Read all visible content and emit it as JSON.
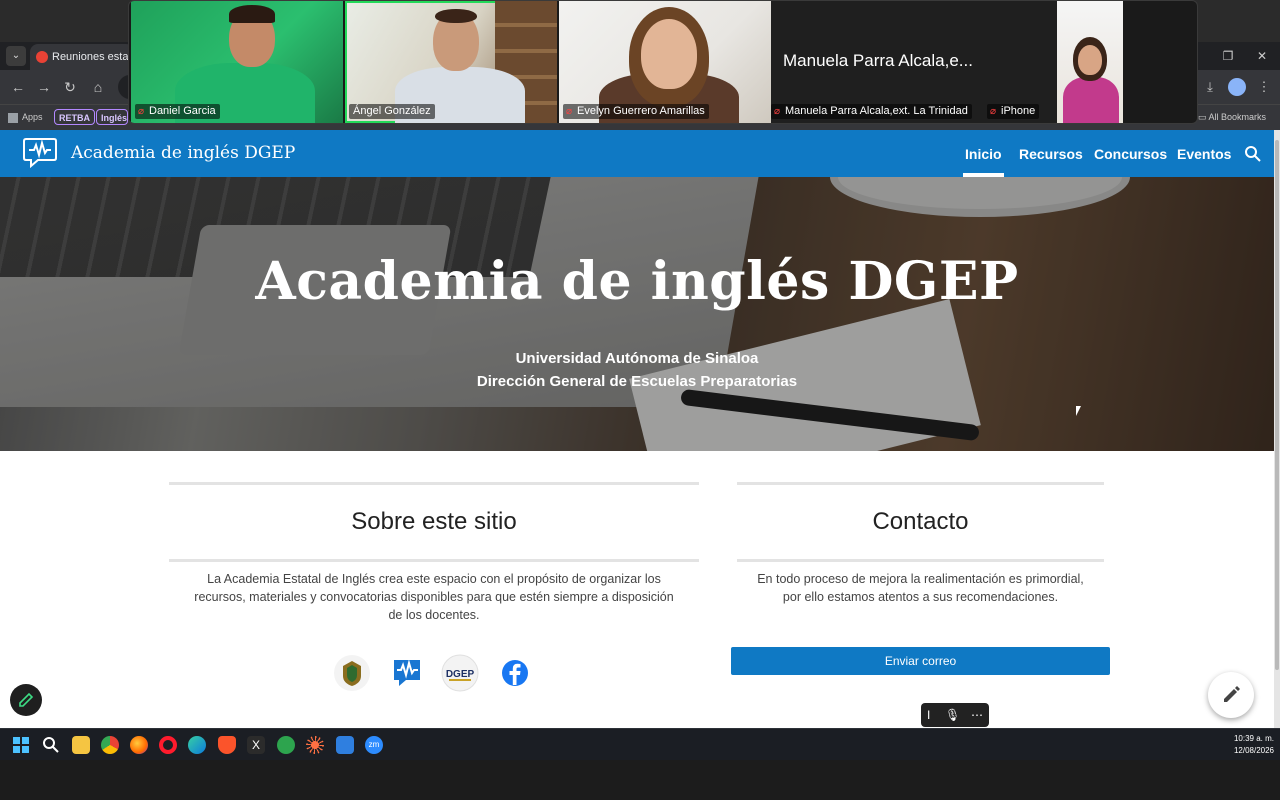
{
  "browser": {
    "tab_title": "Reuniones estatale",
    "bookmarks": {
      "apps": "Apps",
      "retba": "RETBA",
      "ingles": "Inglés",
      "all_bookmarks": "All Bookmarks"
    }
  },
  "zoom": {
    "participants": [
      {
        "name": "Daniel Garcia"
      },
      {
        "name": "Ángel González"
      },
      {
        "name": "Evelyn Guerrero Amarillas"
      },
      {
        "name": "Manuela Parra Alcala,ext. La Trinidad",
        "display": "Manuela Parra Alcala,e..."
      },
      {
        "name": "iPhone"
      }
    ]
  },
  "site": {
    "title": "Academia de inglés DGEP",
    "nav": [
      {
        "label": "Inicio",
        "active": true
      },
      {
        "label": "Recursos"
      },
      {
        "label": "Concursos"
      },
      {
        "label": "Eventos"
      }
    ],
    "hero": {
      "title": "Academia de inglés DGEP",
      "line1": "Universidad Autónoma de Sinaloa",
      "line2": "Dirección General de Escuelas Preparatorias"
    },
    "about": {
      "heading": "Sobre este sitio",
      "text": "La Academia Estatal de Inglés crea este espacio con el propósito de organizar los recursos, materiales y convocatorias disponibles para que estén siempre a disposición de los docentes.",
      "icons": [
        "uas-seal-icon",
        "academia-logo-icon",
        "dgep-logo-icon",
        "facebook-icon"
      ],
      "dgep_label": "DGEP"
    },
    "contact": {
      "heading": "Contacto",
      "text": "En todo proceso de mejora la realimentación es primordial, por ello estamos atentos a sus recomendaciones.",
      "button": "Enviar correo"
    }
  },
  "taskbar": {
    "time": "10:39 a. m.",
    "date": "12/08/2026"
  },
  "colors": {
    "brand_blue": "#0f79c4",
    "zoom_active": "#23d959"
  }
}
